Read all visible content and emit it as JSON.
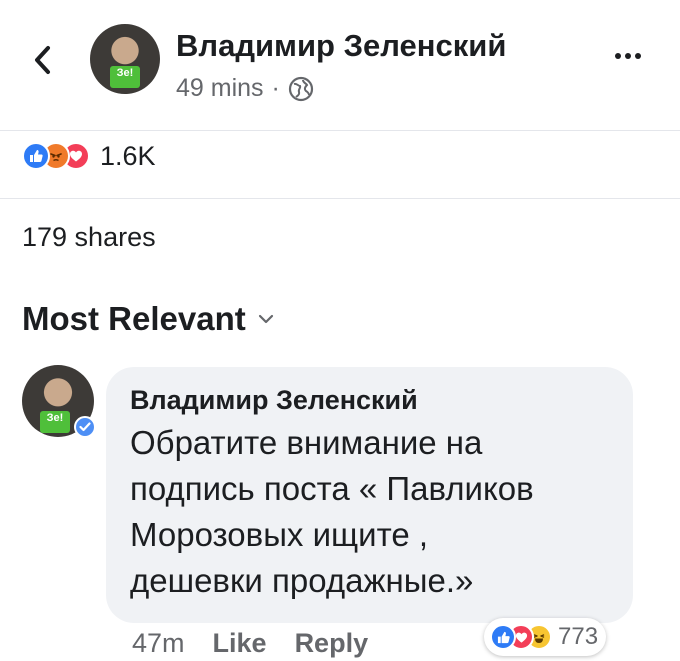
{
  "post_header": {
    "author_name": "Владимир Зеленский",
    "timestamp": "49 mins",
    "separator": "·",
    "privacy_icon": "globe-icon",
    "avatar_badge_text": "Зе!"
  },
  "post_stats": {
    "reactions": [
      "like",
      "angry",
      "love"
    ],
    "reaction_count": "1.6K",
    "shares_text": "179 shares"
  },
  "comments_section": {
    "sort_label": "Most Relevant",
    "sort_icon": "chevron-down-icon"
  },
  "comment": {
    "author_name": "Владимир Зеленский",
    "verified": true,
    "avatar_badge_text": "Зе!",
    "text": "Обратите внимание на\nподпись поста « Павликов\nМорозовых ищите ,\nдешевки продажные.»",
    "time": "47m",
    "like_label": "Like",
    "reply_label": "Reply",
    "reactions": [
      "like",
      "love",
      "haha"
    ],
    "reaction_count": "773"
  },
  "colors": {
    "like_blue": "#2e7bf6",
    "love_red": "#f33e58",
    "angry_orange": "#f07a2a",
    "haha_yellow": "#f7c531",
    "secondary_text": "#65676b",
    "bubble_bg": "#f0f2f5"
  }
}
